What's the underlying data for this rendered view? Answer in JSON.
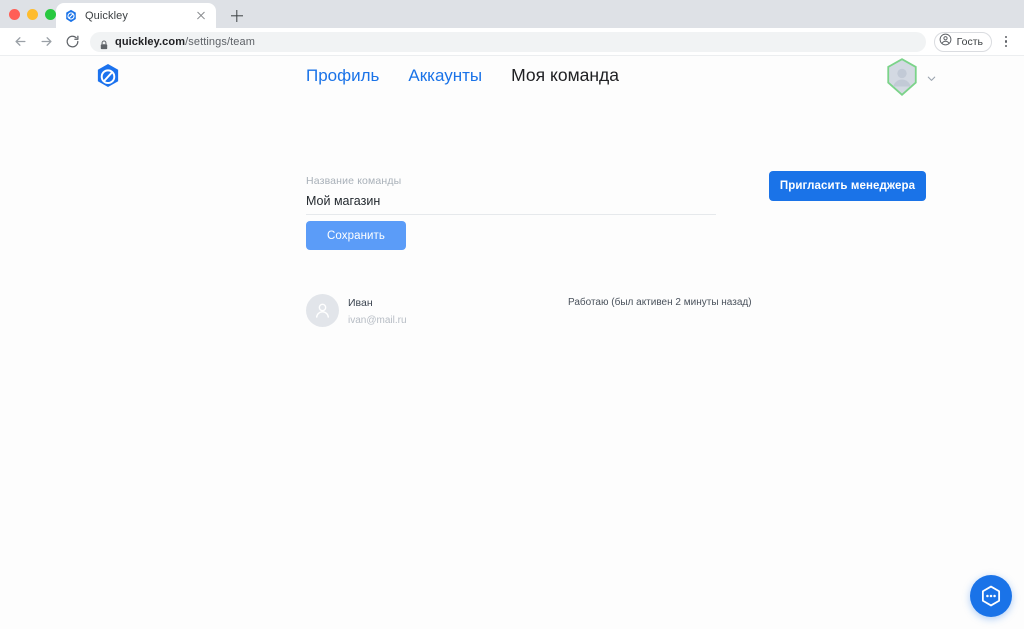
{
  "browser": {
    "traffic_lights": [
      "close",
      "minimize",
      "zoom"
    ],
    "tab": {
      "title": "Quickley",
      "favicon": "quickley-logo-icon",
      "close_icon": "close-icon"
    },
    "new_tab_label": "+",
    "nav": {
      "back_icon": "arrow-back-icon",
      "forward_icon": "arrow-forward-icon",
      "reload_icon": "reload-icon"
    },
    "omnibox": {
      "lock_icon": "lock-icon",
      "url_domain": "quickley.com",
      "url_path": "/settings/team",
      "full_url": "quickley.com/settings/team"
    },
    "profile": {
      "icon": "person-icon",
      "label": "Гость"
    },
    "menu_icon": "kebab-menu-icon"
  },
  "app": {
    "logo_icon": "quickley-hex-logo-icon",
    "nav": [
      {
        "label": "Профиль",
        "active": false
      },
      {
        "label": "Аккаунты",
        "active": false
      },
      {
        "label": "Моя команда",
        "active": true
      }
    ],
    "user_menu": {
      "avatar_icon": "user-avatar-hexagon-icon",
      "chevron_icon": "chevron-down-icon"
    }
  },
  "form": {
    "team_name_label": "Название команды",
    "team_name_value": "Мой магазин",
    "save_label": "Сохранить"
  },
  "actions": {
    "invite_label": "Пригласить менеджера"
  },
  "members": [
    {
      "avatar_icon": "person-avatar-icon",
      "name": "Иван",
      "email": "ivan@mail.ru",
      "status": "Работаю  (был активен 2 минуты назад)"
    }
  ],
  "chat": {
    "icon": "chat-bubble-dots-icon"
  },
  "colors": {
    "accent_blue": "#1a73e8",
    "link_blue": "#1a73e8",
    "save_blue": "#5b9cf8",
    "text_dark": "#202124",
    "muted": "#a8b0b8",
    "avatar_ring_green": "#7bd389",
    "page_bg": "#fdfdfd"
  }
}
